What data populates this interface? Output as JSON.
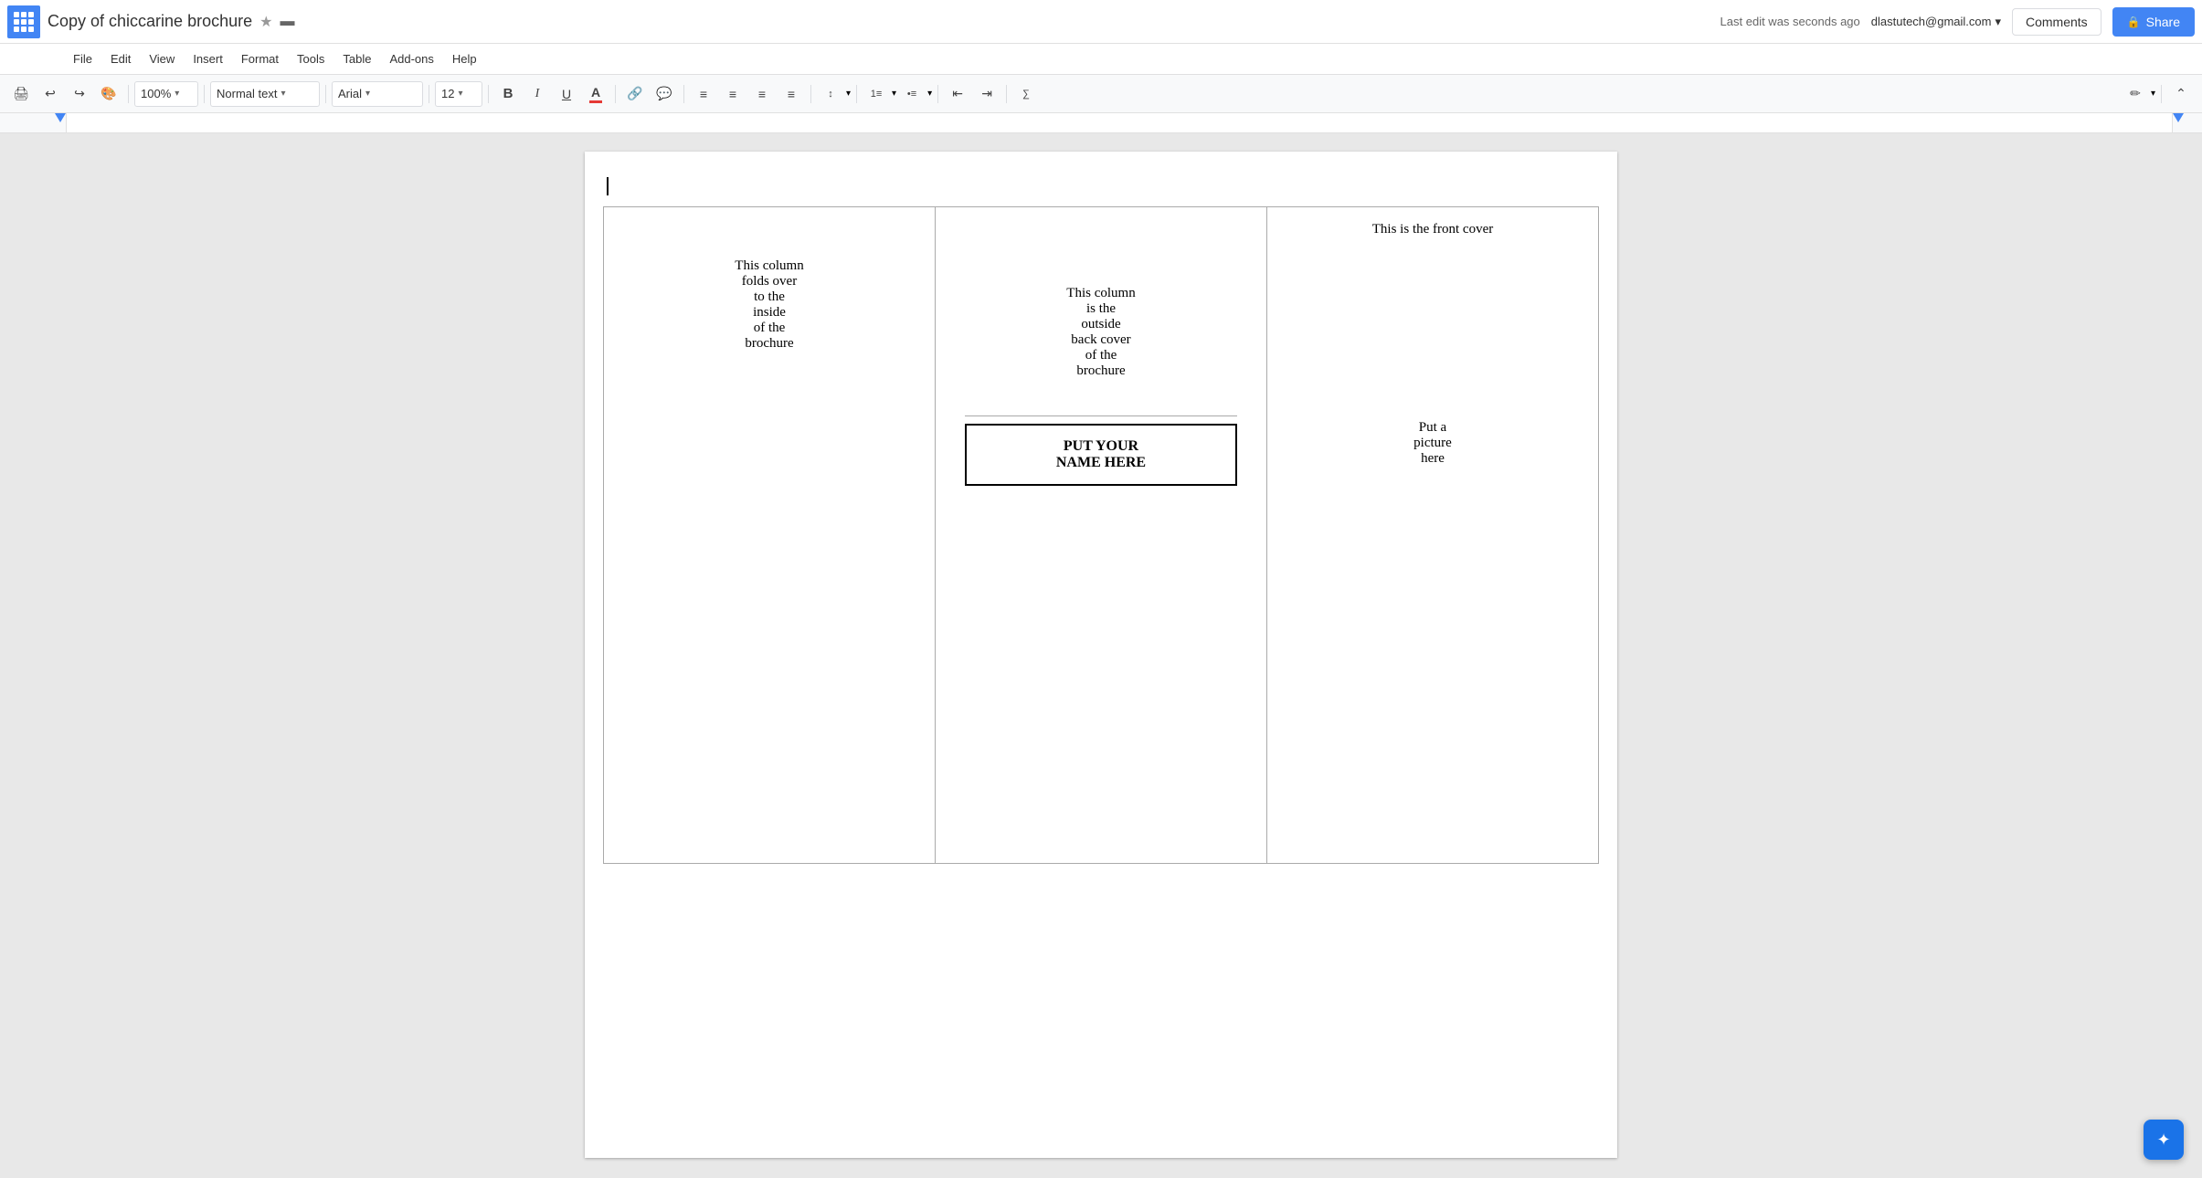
{
  "header": {
    "app_icon_label": "Google Apps",
    "title": "Copy of chiccarine brochure",
    "star_icon": "★",
    "folder_icon": "🗁",
    "user_email": "dlastutech@gmail.com",
    "user_dropdown_icon": "▾",
    "last_edit": "Last edit was seconds ago",
    "comments_label": "Comments",
    "share_label": "Share",
    "share_lock_icon": "🔒"
  },
  "menu": {
    "items": [
      "File",
      "Edit",
      "View",
      "Insert",
      "Format",
      "Tools",
      "Table",
      "Add-ons",
      "Help"
    ]
  },
  "toolbar": {
    "zoom": "100%",
    "style": "Normal text",
    "font": "Arial",
    "size": "12",
    "bold": "B",
    "italic": "I",
    "underline": "U",
    "text_color": "A"
  },
  "brochure": {
    "col_left_text": "This column folds over to the inside of the brochure",
    "col_middle_top_text": "This column is the outside back cover of the brochure",
    "name_box_text": "PUT YOUR NAME HERE",
    "col_right_top_text": "This is the front cover",
    "col_right_bottom_text": "Put a picture here"
  }
}
